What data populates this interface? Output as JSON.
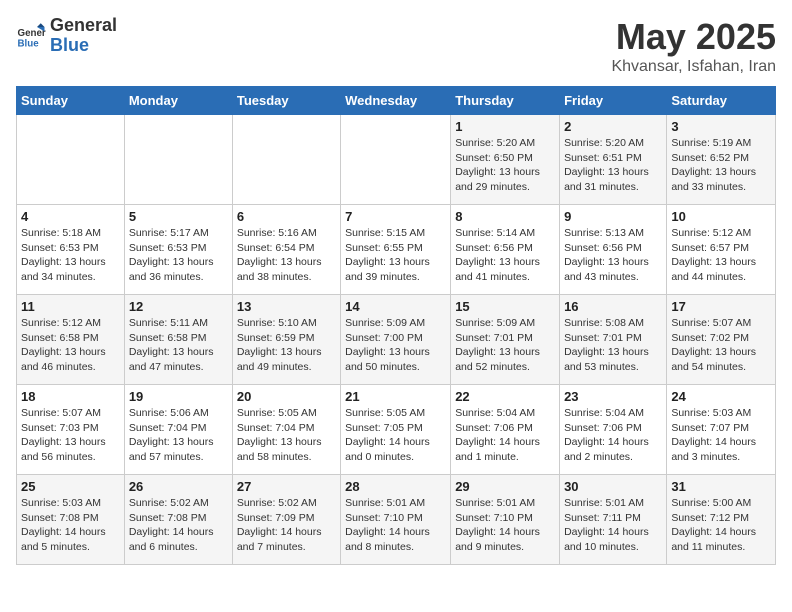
{
  "header": {
    "logo_line1": "General",
    "logo_line2": "Blue",
    "title": "May 2025",
    "subtitle": "Khvansar, Isfahan, Iran"
  },
  "days_of_week": [
    "Sunday",
    "Monday",
    "Tuesday",
    "Wednesday",
    "Thursday",
    "Friday",
    "Saturday"
  ],
  "weeks": [
    [
      {
        "num": "",
        "info": ""
      },
      {
        "num": "",
        "info": ""
      },
      {
        "num": "",
        "info": ""
      },
      {
        "num": "",
        "info": ""
      },
      {
        "num": "1",
        "info": "Sunrise: 5:20 AM\nSunset: 6:50 PM\nDaylight: 13 hours\nand 29 minutes."
      },
      {
        "num": "2",
        "info": "Sunrise: 5:20 AM\nSunset: 6:51 PM\nDaylight: 13 hours\nand 31 minutes."
      },
      {
        "num": "3",
        "info": "Sunrise: 5:19 AM\nSunset: 6:52 PM\nDaylight: 13 hours\nand 33 minutes."
      }
    ],
    [
      {
        "num": "4",
        "info": "Sunrise: 5:18 AM\nSunset: 6:53 PM\nDaylight: 13 hours\nand 34 minutes."
      },
      {
        "num": "5",
        "info": "Sunrise: 5:17 AM\nSunset: 6:53 PM\nDaylight: 13 hours\nand 36 minutes."
      },
      {
        "num": "6",
        "info": "Sunrise: 5:16 AM\nSunset: 6:54 PM\nDaylight: 13 hours\nand 38 minutes."
      },
      {
        "num": "7",
        "info": "Sunrise: 5:15 AM\nSunset: 6:55 PM\nDaylight: 13 hours\nand 39 minutes."
      },
      {
        "num": "8",
        "info": "Sunrise: 5:14 AM\nSunset: 6:56 PM\nDaylight: 13 hours\nand 41 minutes."
      },
      {
        "num": "9",
        "info": "Sunrise: 5:13 AM\nSunset: 6:56 PM\nDaylight: 13 hours\nand 43 minutes."
      },
      {
        "num": "10",
        "info": "Sunrise: 5:12 AM\nSunset: 6:57 PM\nDaylight: 13 hours\nand 44 minutes."
      }
    ],
    [
      {
        "num": "11",
        "info": "Sunrise: 5:12 AM\nSunset: 6:58 PM\nDaylight: 13 hours\nand 46 minutes."
      },
      {
        "num": "12",
        "info": "Sunrise: 5:11 AM\nSunset: 6:58 PM\nDaylight: 13 hours\nand 47 minutes."
      },
      {
        "num": "13",
        "info": "Sunrise: 5:10 AM\nSunset: 6:59 PM\nDaylight: 13 hours\nand 49 minutes."
      },
      {
        "num": "14",
        "info": "Sunrise: 5:09 AM\nSunset: 7:00 PM\nDaylight: 13 hours\nand 50 minutes."
      },
      {
        "num": "15",
        "info": "Sunrise: 5:09 AM\nSunset: 7:01 PM\nDaylight: 13 hours\nand 52 minutes."
      },
      {
        "num": "16",
        "info": "Sunrise: 5:08 AM\nSunset: 7:01 PM\nDaylight: 13 hours\nand 53 minutes."
      },
      {
        "num": "17",
        "info": "Sunrise: 5:07 AM\nSunset: 7:02 PM\nDaylight: 13 hours\nand 54 minutes."
      }
    ],
    [
      {
        "num": "18",
        "info": "Sunrise: 5:07 AM\nSunset: 7:03 PM\nDaylight: 13 hours\nand 56 minutes."
      },
      {
        "num": "19",
        "info": "Sunrise: 5:06 AM\nSunset: 7:04 PM\nDaylight: 13 hours\nand 57 minutes."
      },
      {
        "num": "20",
        "info": "Sunrise: 5:05 AM\nSunset: 7:04 PM\nDaylight: 13 hours\nand 58 minutes."
      },
      {
        "num": "21",
        "info": "Sunrise: 5:05 AM\nSunset: 7:05 PM\nDaylight: 14 hours\nand 0 minutes."
      },
      {
        "num": "22",
        "info": "Sunrise: 5:04 AM\nSunset: 7:06 PM\nDaylight: 14 hours\nand 1 minute."
      },
      {
        "num": "23",
        "info": "Sunrise: 5:04 AM\nSunset: 7:06 PM\nDaylight: 14 hours\nand 2 minutes."
      },
      {
        "num": "24",
        "info": "Sunrise: 5:03 AM\nSunset: 7:07 PM\nDaylight: 14 hours\nand 3 minutes."
      }
    ],
    [
      {
        "num": "25",
        "info": "Sunrise: 5:03 AM\nSunset: 7:08 PM\nDaylight: 14 hours\nand 5 minutes."
      },
      {
        "num": "26",
        "info": "Sunrise: 5:02 AM\nSunset: 7:08 PM\nDaylight: 14 hours\nand 6 minutes."
      },
      {
        "num": "27",
        "info": "Sunrise: 5:02 AM\nSunset: 7:09 PM\nDaylight: 14 hours\nand 7 minutes."
      },
      {
        "num": "28",
        "info": "Sunrise: 5:01 AM\nSunset: 7:10 PM\nDaylight: 14 hours\nand 8 minutes."
      },
      {
        "num": "29",
        "info": "Sunrise: 5:01 AM\nSunset: 7:10 PM\nDaylight: 14 hours\nand 9 minutes."
      },
      {
        "num": "30",
        "info": "Sunrise: 5:01 AM\nSunset: 7:11 PM\nDaylight: 14 hours\nand 10 minutes."
      },
      {
        "num": "31",
        "info": "Sunrise: 5:00 AM\nSunset: 7:12 PM\nDaylight: 14 hours\nand 11 minutes."
      }
    ]
  ]
}
